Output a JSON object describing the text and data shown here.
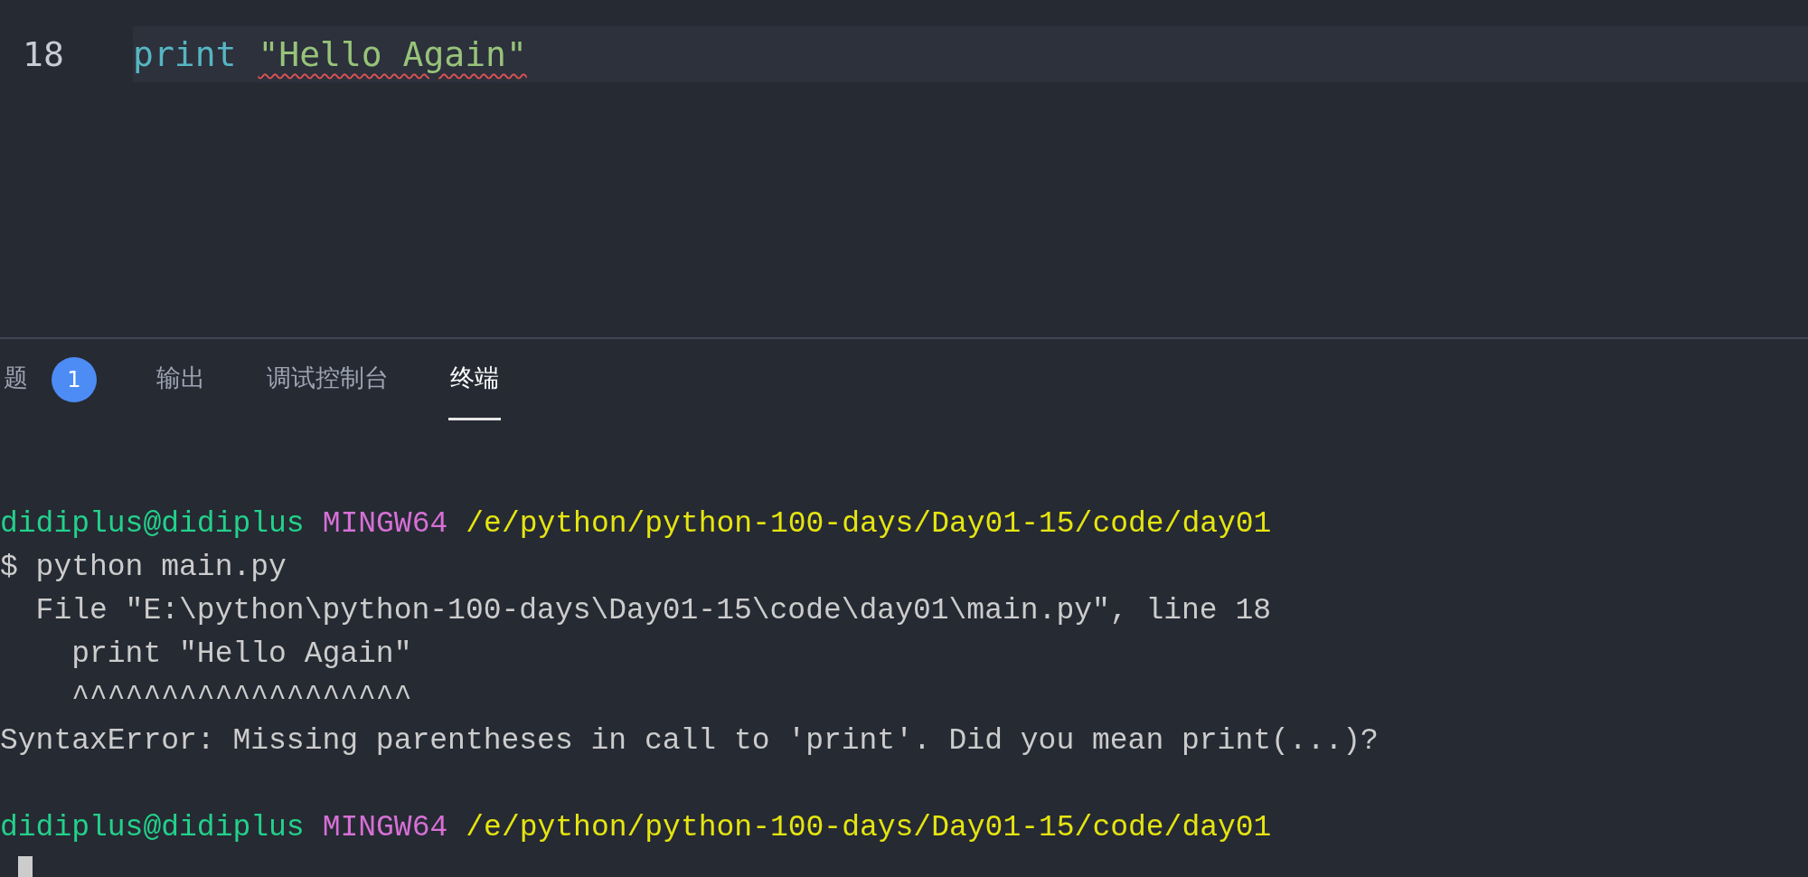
{
  "editor": {
    "lines": [
      {
        "number": "18",
        "current": true,
        "keyword": "print",
        "string": "\"Hello Again\"",
        "error": true
      }
    ]
  },
  "panel": {
    "tabs": [
      {
        "label": "题",
        "badge": "1",
        "selected": false
      },
      {
        "label": "输出",
        "selected": false
      },
      {
        "label": "调试控制台",
        "selected": false
      },
      {
        "label": "终端",
        "selected": true
      }
    ]
  },
  "terminal": {
    "lines": [
      {
        "kind": "blank"
      },
      {
        "kind": "prompt",
        "user": "didiplus@didiplus",
        "shell": "MINGW64",
        "path": "/e/python/python-100-days/Day01-15/code/day01"
      },
      {
        "kind": "text",
        "text": "$ python main.py"
      },
      {
        "kind": "text",
        "text": "  File \"E:\\python\\python-100-days\\Day01-15\\code\\day01\\main.py\", line 18"
      },
      {
        "kind": "text",
        "text": "    print \"Hello Again\""
      },
      {
        "kind": "text",
        "text": "    ^^^^^^^^^^^^^^^^^^^"
      },
      {
        "kind": "text",
        "text": "SyntaxError: Missing parentheses in call to 'print'. Did you mean print(...)?"
      },
      {
        "kind": "blank"
      },
      {
        "kind": "prompt",
        "user": "didiplus@didiplus",
        "shell": "MINGW64",
        "path": "/e/python/python-100-days/Day01-15/code/day01"
      },
      {
        "kind": "input",
        "cursor": true
      }
    ]
  }
}
